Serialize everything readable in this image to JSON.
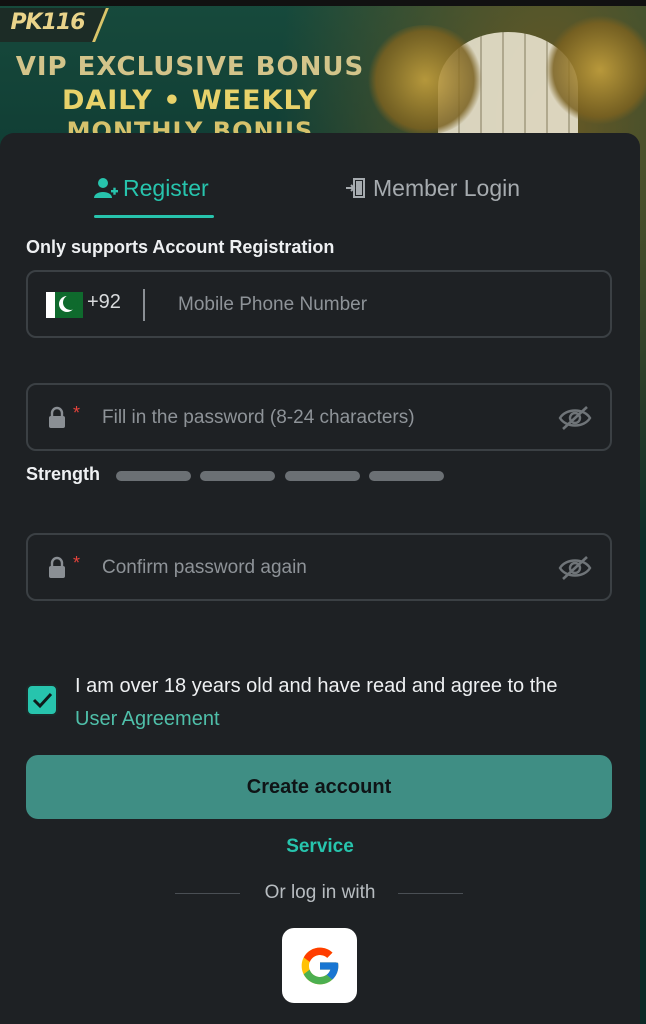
{
  "banner": {
    "logo": "PK116",
    "line1": "VIP EXCLUSIVE BONUS",
    "line2": "DAILY • WEEKLY",
    "line3": "MONTHLY BONUS"
  },
  "tabs": {
    "register_label": "Register",
    "login_label": "Member Login",
    "active": "register"
  },
  "form": {
    "info_text": "Only supports Account Registration",
    "country_code": "+92",
    "country": "Pakistan",
    "phone_placeholder": "Mobile Phone Number",
    "password_placeholder": "Fill in the password (8-24 characters)",
    "confirm_placeholder": "Confirm password again",
    "required_mark": "*",
    "strength_label": "Strength",
    "strength_segments": 4,
    "strength_filled": 0
  },
  "agreement": {
    "checked": true,
    "text": "I am over 18 years old and have read and agree to the",
    "link_text": "User Agreement"
  },
  "actions": {
    "create_label": "Create account",
    "service_label": "Service",
    "alt_login_label": "Or log in with"
  },
  "colors": {
    "accent": "#27c4ad",
    "button": "#3f8e84",
    "card_bg": "#1e2124",
    "required": "#e5433c"
  },
  "icons": {
    "register_tab": "user-plus-icon",
    "login_tab": "door-enter-icon",
    "lock": "lock-icon",
    "eye": "eye-off-icon",
    "check": "checkmark-icon",
    "google": "google-icon"
  }
}
